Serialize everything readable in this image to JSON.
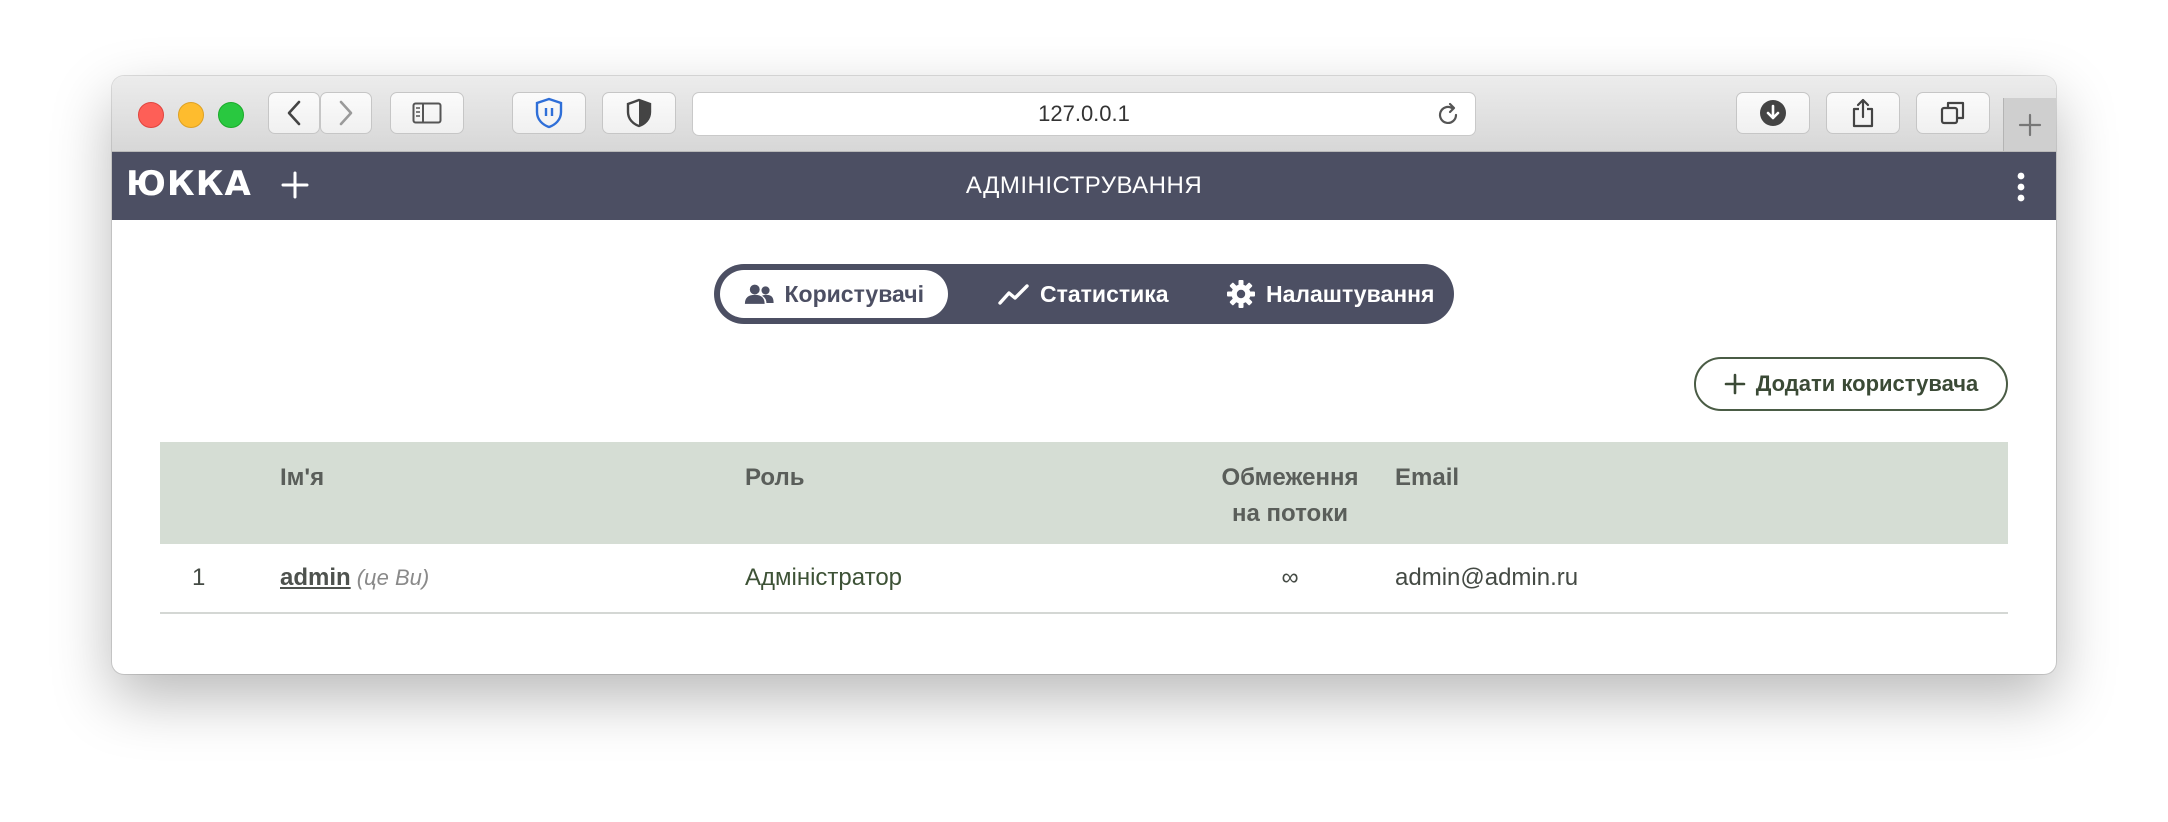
{
  "browser": {
    "url": "127.0.0.1"
  },
  "app": {
    "logo": "ЮККА",
    "title": "АДМІНІСТРУВАННЯ"
  },
  "tabs": [
    {
      "label": "Користувачі",
      "icon": "users-icon",
      "active": true
    },
    {
      "label": "Статистика",
      "icon": "chart-line-icon",
      "active": false
    },
    {
      "label": "Налаштування",
      "icon": "gear-icon",
      "active": false
    }
  ],
  "actions": {
    "add_user_label": "Додати користувача"
  },
  "table": {
    "columns": [
      "Ім'я",
      "Роль",
      "Обмеження на потоки",
      "Email"
    ],
    "column_limit_line1": "Обмеження",
    "column_limit_line2": "на потоки",
    "rows": [
      {
        "index": "1",
        "name": "admin",
        "note": "(це Ви)",
        "role": "Адміністратор",
        "limit": "∞",
        "email": "admin@admin.ru"
      }
    ]
  },
  "colors": {
    "header_bg": "#4c4f63",
    "table_head_bg": "#d5ddd4",
    "accent_green": "#4a5c45"
  }
}
